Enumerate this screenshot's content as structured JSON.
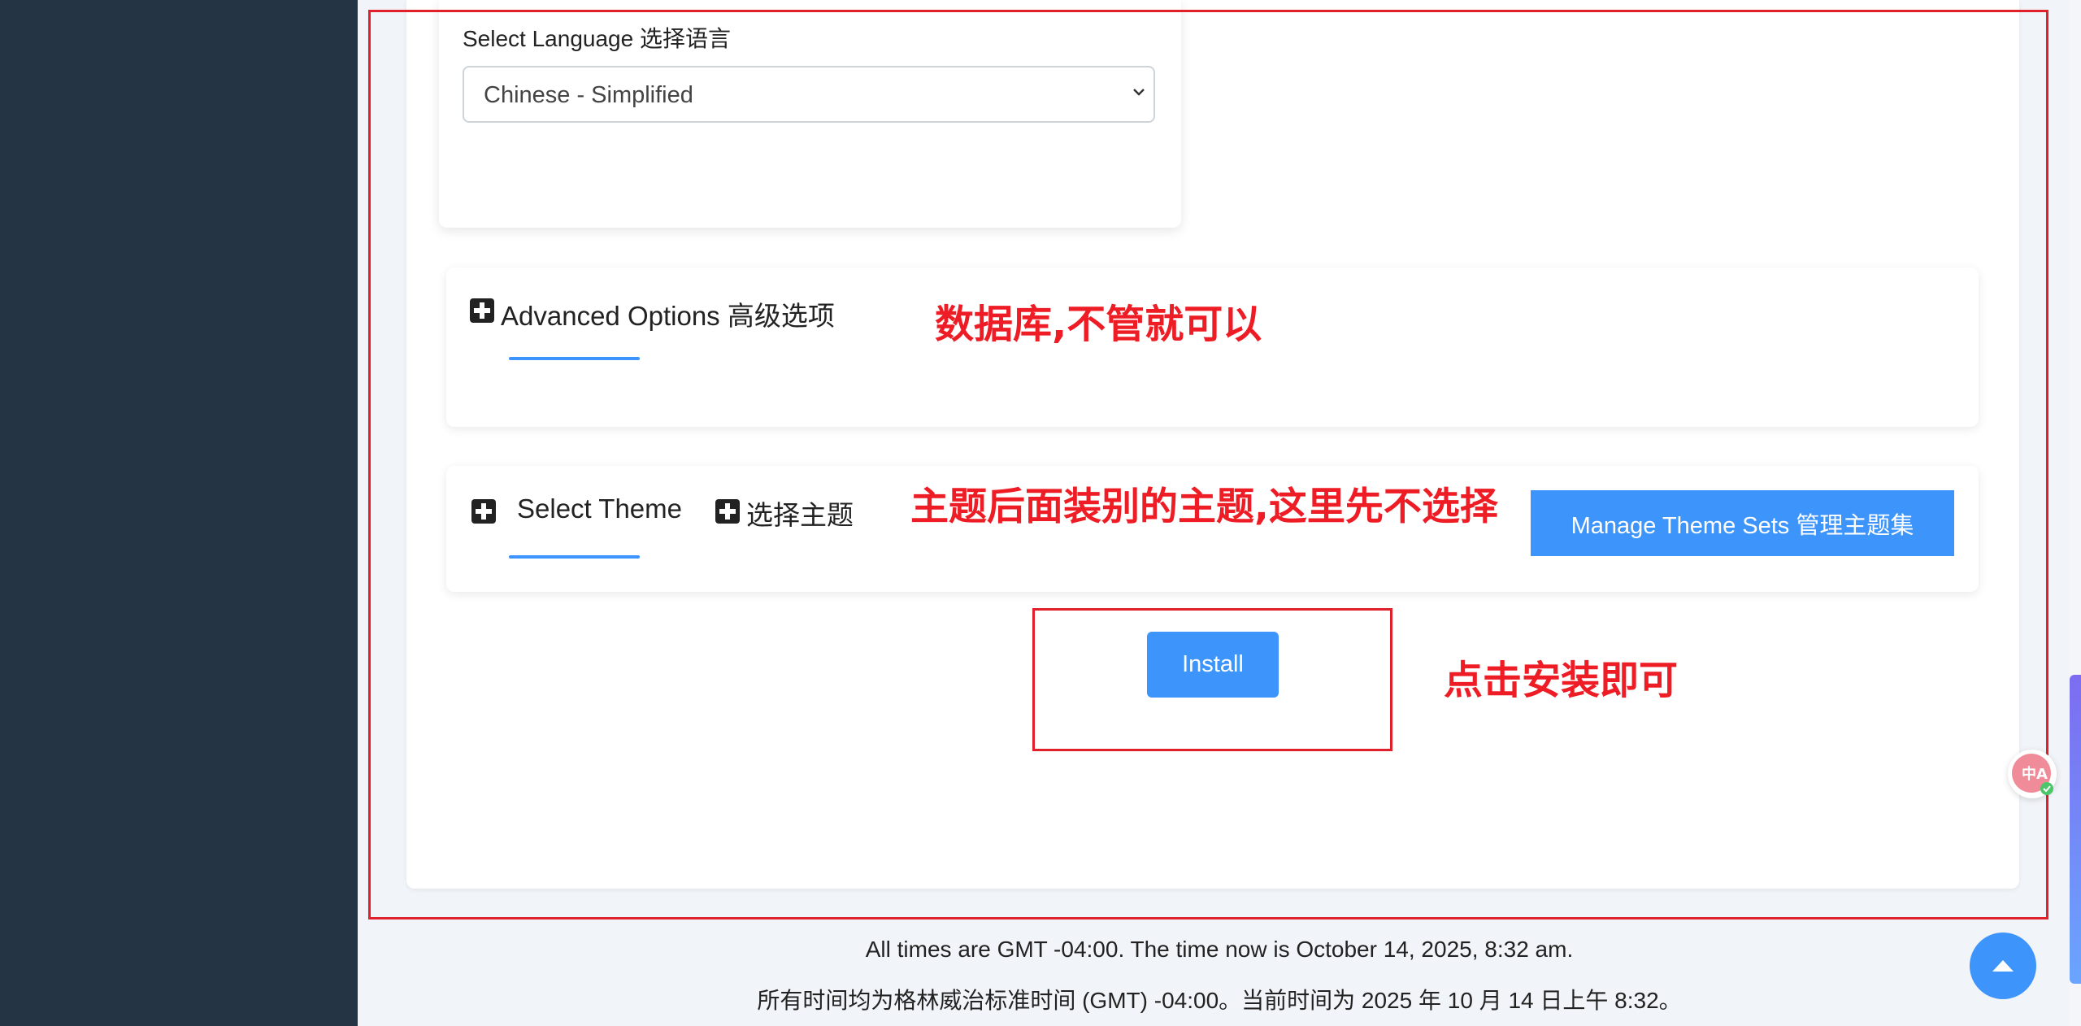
{
  "language": {
    "label": "Select Language  选择语言",
    "selected": "Chinese - Simplified"
  },
  "advanced": {
    "title": "Advanced Options  高级选项"
  },
  "theme": {
    "title": "Select Theme",
    "title_cn": "选择主题",
    "manage_button": "Manage Theme Sets  管理主题集"
  },
  "install": {
    "button": "Install"
  },
  "annotations": {
    "database": "数据库,不管就可以",
    "theme": "主题后面装别的主题,这里先不选择",
    "install": "点击安装即可"
  },
  "footer": {
    "line_en": "All times are GMT -04:00. The time now is October 14, 2025, 8:32 am.",
    "line_cn": "所有时间均为格林威治标准时间 (GMT) -04:00。当前时间为 2025 年 10 月 14 日上午 8:32。"
  },
  "icons": {
    "plus": "plus-square-icon",
    "chevron": "chevron-down-icon",
    "scroll_top": "arrow-up-icon",
    "translate": "translate-icon"
  },
  "colors": {
    "sidebar": "#253444",
    "accent": "#3d95fb",
    "annotation": "#ee1d25"
  }
}
